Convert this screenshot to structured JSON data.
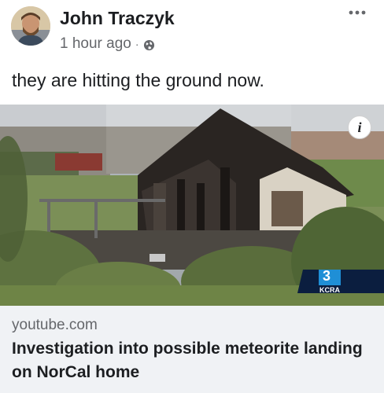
{
  "post": {
    "author": "John Traczyk",
    "timestamp": "1 hour ago",
    "separator": "·",
    "audience_icon": "globe-icon",
    "more_icon": "more-options-icon",
    "text": "they are hitting the ground now."
  },
  "link_preview": {
    "image_description_icon": "info-icon",
    "info_label": "i",
    "watermark": "KCRA",
    "watermark_number": "3",
    "domain": "youtube.com",
    "title": "Investigation into possible meteorite landing on NorCal home"
  },
  "colors": {
    "text_primary": "#1c1e21",
    "text_secondary": "#65676b",
    "footer_bg": "#f0f2f5"
  }
}
